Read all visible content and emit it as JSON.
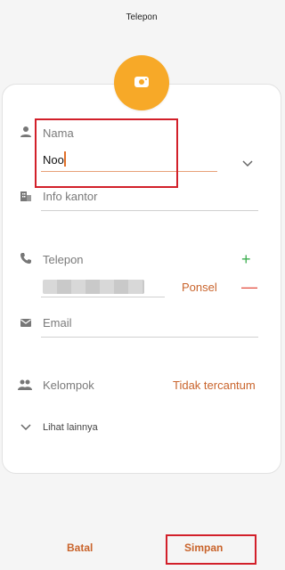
{
  "header": {
    "title": "Telepon"
  },
  "colors": {
    "accent": "#c9642c",
    "avatar": "#f7a928",
    "add": "#3cae4f",
    "remove": "#e34b3d",
    "highlight": "#d2202a"
  },
  "form": {
    "name": {
      "label": "Nama",
      "value": "Noo"
    },
    "company": {
      "placeholder": "Info kantor"
    },
    "phone": {
      "label": "Telepon",
      "type_label": "Ponsel",
      "add_symbol": "+",
      "remove_symbol": "—"
    },
    "email": {
      "placeholder": "Email"
    },
    "group": {
      "label": "Kelompok",
      "value": "Tidak tercantum"
    },
    "more": {
      "label": "Lihat lainnya"
    }
  },
  "footer": {
    "cancel_label": "Batal",
    "save_label": "Simpan"
  },
  "icons": {
    "avatar": "camera-icon",
    "name": "person-icon",
    "company": "building-icon",
    "phone": "phone-icon",
    "email": "mail-icon",
    "group": "people-icon",
    "more": "chevron-down-icon"
  }
}
